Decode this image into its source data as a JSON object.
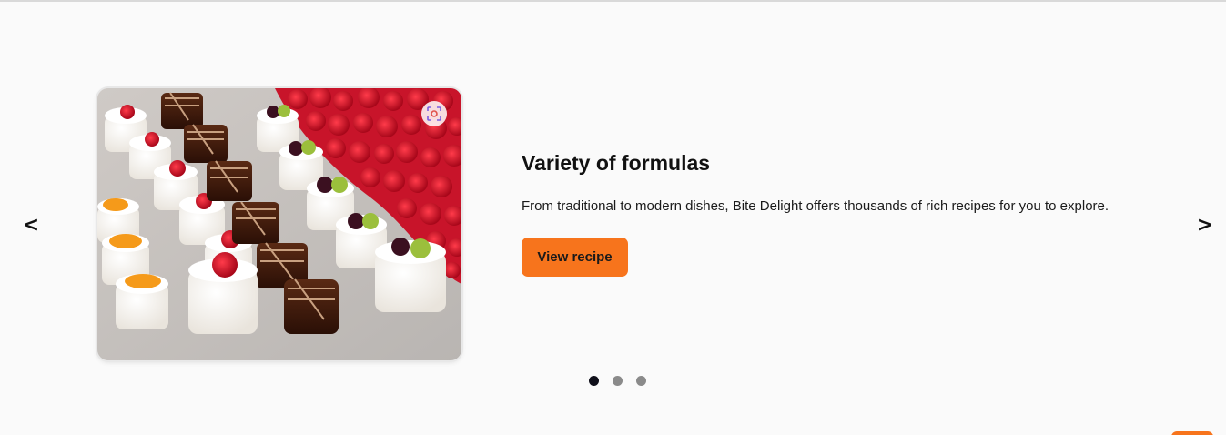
{
  "carousel": {
    "prev_label": "<",
    "next_label": ">",
    "slide": {
      "title": "Variety of formulas",
      "description": "From traditional to modern dishes, Bite Delight offers thousands of rich recipes for you to explore.",
      "button_label": "View recipe",
      "image_subject": "assorted petit four pastries on a tray"
    },
    "dots": {
      "total": 3,
      "active": 1
    }
  },
  "colors": {
    "background": "#fafafa",
    "accent": "#f7741c",
    "dot_active": "#0f0f1a",
    "dot_inactive": "#8a8a8a"
  },
  "icons": {
    "lens": "visual-search-icon"
  }
}
